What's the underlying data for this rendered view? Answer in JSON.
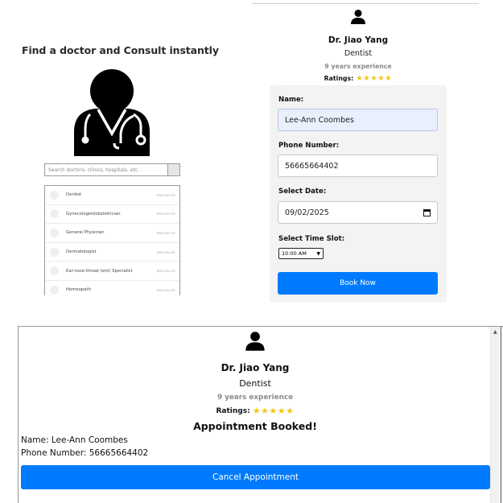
{
  "left": {
    "title": "Find a doctor and Consult instantly",
    "search": {
      "placeholder": "Search doctors, clinics, hospitals, etc."
    },
    "specialties": [
      {
        "name": "Dentist",
        "tag": "SPECIALITY"
      },
      {
        "name": "Gynecologist/obstetrician",
        "tag": "SPECIALITY"
      },
      {
        "name": "General Physician",
        "tag": "SPECIALITY"
      },
      {
        "name": "Dermatologist",
        "tag": "SPECIALITY"
      },
      {
        "name": "Ear-nose-throat (ent) Specialist",
        "tag": "SPECIALITY"
      },
      {
        "name": "Homeopath",
        "tag": "SPECIALITY"
      }
    ]
  },
  "booking": {
    "doctor_name": "Dr. Jiao Yang",
    "specialty": "Dentist",
    "experience": "9 years experience",
    "ratings_label": "Ratings:",
    "stars": "★★★★★",
    "form": {
      "name_label": "Name:",
      "name_value": "Lee-Ann Coombes",
      "phone_label": "Phone Number:",
      "phone_value": "56665664402",
      "date_label": "Select Date:",
      "date_value": "09/02/2025",
      "time_label": "Select Time Slot:",
      "time_value": "10:00 AM",
      "submit_label": "Book Now"
    }
  },
  "confirmation": {
    "doctor_name": "Dr. Jiao Yang",
    "specialty": "Dentist",
    "experience": "9 years experience",
    "ratings_label": "Ratings:",
    "stars": "★★★★★",
    "status": "Appointment Booked!",
    "name_line": "Name: Lee-Ann Coombes",
    "phone_line": "Phone Number: 56665664402",
    "cancel_label": "Cancel Appointment"
  },
  "colors": {
    "primary": "#007bff",
    "star": "#f5c518",
    "muted_text": "#8a8a8a",
    "autofill_bg": "#e8f0fe"
  }
}
